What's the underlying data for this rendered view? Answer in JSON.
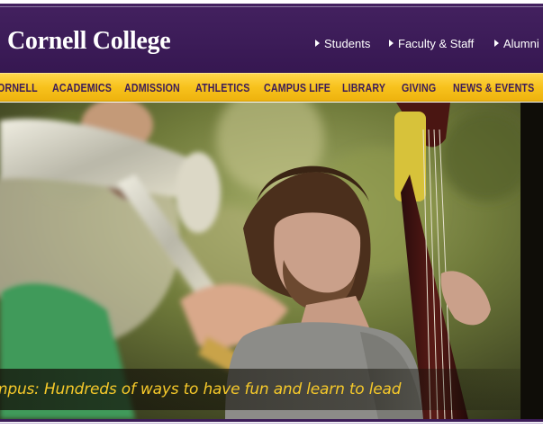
{
  "header": {
    "logo_text": "Cornell College",
    "links": [
      {
        "label": "Students"
      },
      {
        "label": "Faculty & Staff"
      },
      {
        "label": "Alumni"
      }
    ]
  },
  "nav": {
    "items": [
      {
        "label": "ORNELL"
      },
      {
        "label": "ACADEMICS"
      },
      {
        "label": "ADMISSION"
      },
      {
        "label": "ATHLETICS"
      },
      {
        "label": "CAMPUS LIFE"
      },
      {
        "label": "LIBRARY"
      },
      {
        "label": "GIVING"
      },
      {
        "label": "NEWS & EVENTS"
      }
    ]
  },
  "hero": {
    "caption": "mpus: Hundreds of ways to have fun and learn to lead"
  },
  "colors": {
    "purple": "#3c1c58",
    "gold": "#f7c21c",
    "caption_text": "#f6c92a"
  }
}
